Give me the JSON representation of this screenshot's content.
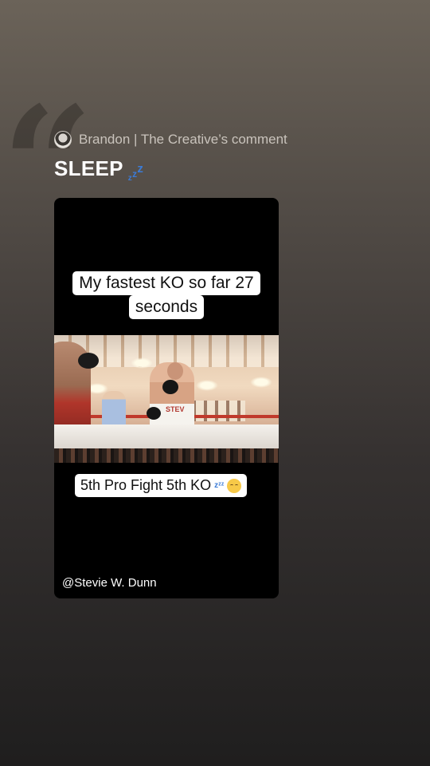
{
  "comment": {
    "author_label": "Brandon | The Creative’s comment",
    "text": "SLEEP",
    "emoji_icon": "zzz-icon"
  },
  "video": {
    "caption_top_line1": "My fastest KO so far 27",
    "caption_top_line2": "seconds",
    "caption_bottom": "5th Pro Fight 5th KO",
    "caption_bottom_emojis": [
      "zzz-icon",
      "sleeping-face-icon"
    ],
    "handle": "@Stevie W. Dunn",
    "trunks_text": "STEV"
  },
  "colors": {
    "background_top": "#6b6359",
    "background_bottom": "#1f1e1e",
    "zzz_blue": "#3b7bd6",
    "caption_bg": "#ffffff"
  }
}
